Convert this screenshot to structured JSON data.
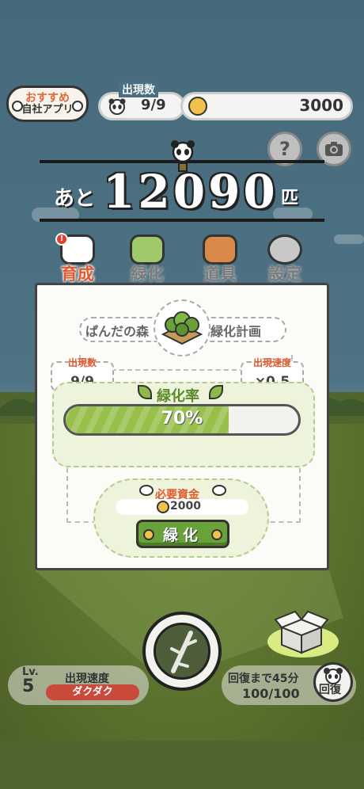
{
  "header": {
    "recommend_line1": "おすすめ",
    "recommend_line2": "自社アプリ",
    "appear_count_label": "出現数",
    "appear_count_value": "9/9",
    "coins_value": "3000",
    "help_label": "?"
  },
  "counter": {
    "prefix": "あと",
    "number": "12090",
    "suffix": "匹"
  },
  "tabs": [
    {
      "label": "育成",
      "active": true
    },
    {
      "label": "緑化",
      "active": false
    },
    {
      "label": "道具",
      "active": false
    },
    {
      "label": "設定",
      "active": false
    }
  ],
  "panel": {
    "title_left": "ぱんだの森",
    "title_right": "緑化計画",
    "appear_count_label": "出現数",
    "appear_count_value": "9/9",
    "appear_speed_label": "出現速度",
    "appear_speed_value": "×0.5",
    "greening_rate_label": "緑化率",
    "greening_rate_text": "70%",
    "greening_rate_fraction": 0.7,
    "required_funds_label": "必要資金",
    "required_funds_value": "2000",
    "green_button_label": "緑化"
  },
  "footer": {
    "level_label": "Lv.",
    "level_value": "5",
    "speed_label": "出現速度",
    "speed_value": "ダクダク",
    "recover_label": "回復まで45分",
    "recover_value": "100/100",
    "recover_button_label": "回復"
  },
  "colors": {
    "accent_orange": "#e05a2e",
    "leaf_green": "#97c04b",
    "sky": "#4e7384",
    "ground": "#51652f"
  },
  "icons": [
    "panda-icon",
    "coin-icon",
    "camera-icon",
    "help-icon",
    "bamboo-icon",
    "leaf-icon",
    "gear-icon",
    "backpack-icon",
    "tree-icon",
    "box-icon"
  ]
}
